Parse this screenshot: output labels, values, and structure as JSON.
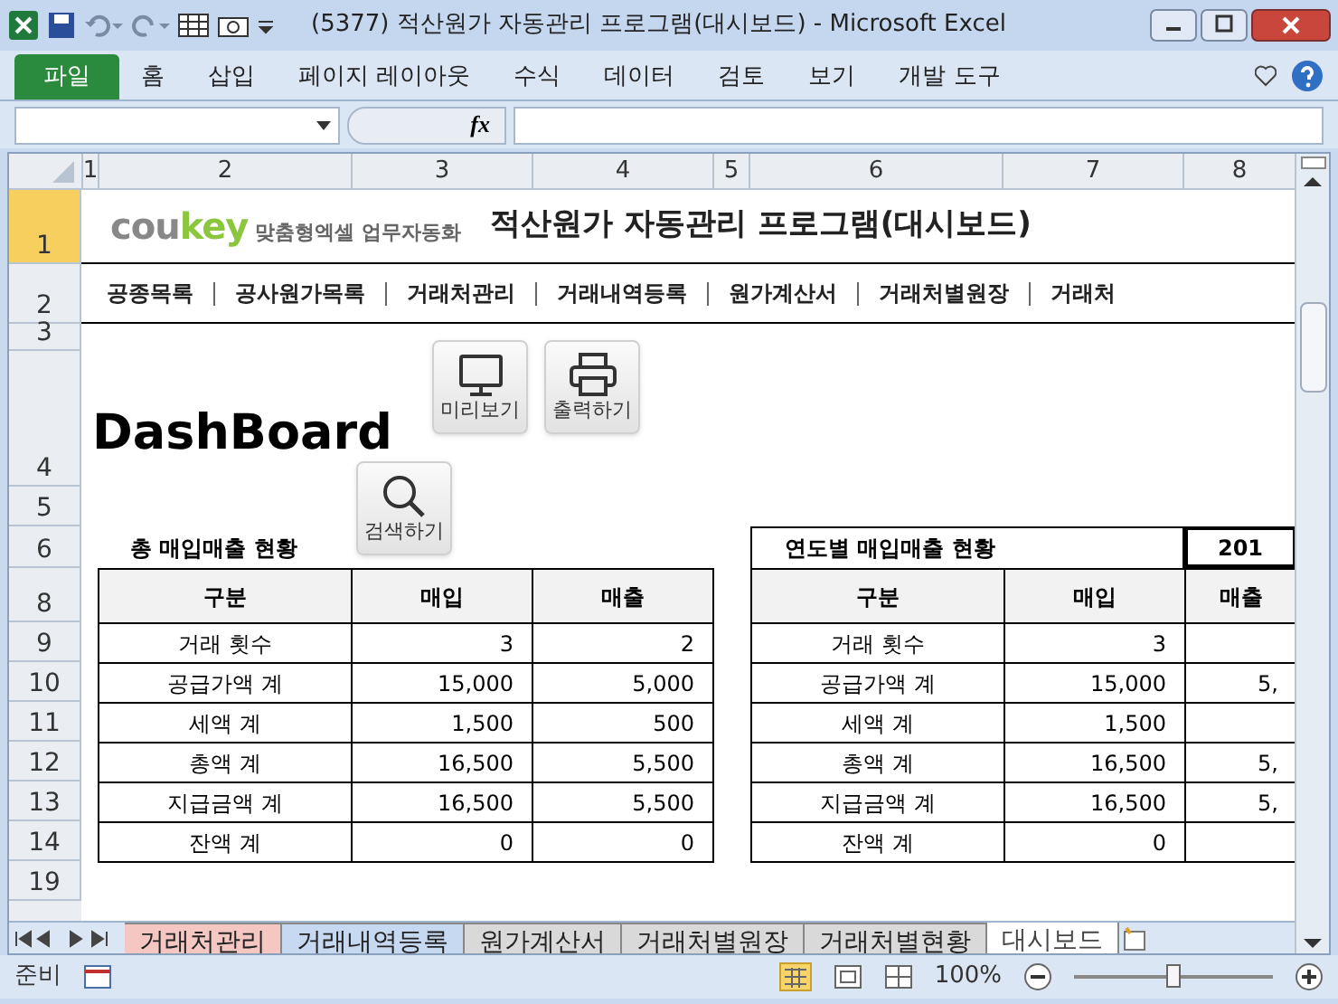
{
  "window": {
    "title": "(5377) 적산원가 자동관리 프로그램(대시보드)  -  Microsoft Excel"
  },
  "ribbon_tabs": [
    {
      "label": "파일",
      "selected": true
    },
    {
      "label": "홈",
      "selected": false
    },
    {
      "label": "삽입",
      "selected": false
    },
    {
      "label": "페이지 레이아웃",
      "selected": false
    },
    {
      "label": "수식",
      "selected": false
    },
    {
      "label": "데이터",
      "selected": false
    },
    {
      "label": "검토",
      "selected": false
    },
    {
      "label": "보기",
      "selected": false
    },
    {
      "label": "개발 도구",
      "selected": false
    }
  ],
  "formula_bar": {
    "fx": "fx"
  },
  "column_headers": [
    "1",
    "2",
    "3",
    "4",
    "5",
    "6",
    "7",
    "8"
  ],
  "row_headers": [
    {
      "label": "1",
      "selected": true
    },
    {
      "label": "2",
      "selected": false
    },
    {
      "label": "3",
      "selected": false
    },
    {
      "label": "4",
      "selected": false
    },
    {
      "label": "5",
      "selected": false
    },
    {
      "label": "6",
      "selected": false
    },
    {
      "label": "8",
      "selected": false
    },
    {
      "label": "9",
      "selected": false
    },
    {
      "label": "10",
      "selected": false
    },
    {
      "label": "11",
      "selected": false
    },
    {
      "label": "12",
      "selected": false
    },
    {
      "label": "13",
      "selected": false
    },
    {
      "label": "14",
      "selected": false
    },
    {
      "label": "19",
      "selected": false
    }
  ],
  "logo": {
    "brand_a": "cou",
    "brand_b": "key",
    "tagline": "맞춤형엑셀 업무자동화"
  },
  "sheet_title": "적산원가 자동관리 프로그램(대시보드)",
  "nav": [
    "공종목록",
    "공사원가목록",
    "거래처관리",
    "거래내역등록",
    "원가계산서",
    "거래처별원장",
    "거래처"
  ],
  "heading": "DashBoard",
  "buttons": [
    {
      "kind": "monitor",
      "label": "미리보기"
    },
    {
      "kind": "printer",
      "label": "출력하기"
    },
    {
      "kind": "search",
      "label": "검색하기"
    }
  ],
  "tables": [
    {
      "title": "총 매입매출 현황",
      "columns": [
        "구분",
        "매입",
        "매출"
      ],
      "rows": [
        [
          "거래 횟수",
          "3",
          "2"
        ],
        [
          "공급가액 계",
          "15,000",
          "5,000"
        ],
        [
          "세액 계",
          "1,500",
          "500"
        ],
        [
          "총액 계",
          "16,500",
          "5,500"
        ],
        [
          "지급금액 계",
          "16,500",
          "5,500"
        ],
        [
          "잔액 계",
          "0",
          "0"
        ]
      ]
    },
    {
      "title": "연도별 매입매출 현황",
      "year": "201",
      "columns": [
        "구분",
        "매입",
        "매출"
      ],
      "rows": [
        [
          "거래 횟수",
          "3",
          ""
        ],
        [
          "공급가액 계",
          "15,000",
          "5,"
        ],
        [
          "세액 계",
          "1,500",
          ""
        ],
        [
          "총액 계",
          "16,500",
          "5,"
        ],
        [
          "지급금액 계",
          "16,500",
          "5,"
        ],
        [
          "잔액 계",
          "0",
          ""
        ]
      ]
    }
  ],
  "sheet_tabs": [
    {
      "label": "거래처관리",
      "color": "#f4c7c3",
      "selected": false
    },
    {
      "label": "거래내역등록",
      "color": "#c6d9f1",
      "selected": false
    },
    {
      "label": "원가계산서",
      "color": "#d9d9d9",
      "selected": false
    },
    {
      "label": "거래처별원장",
      "color": "#d9d9d9",
      "selected": false
    },
    {
      "label": "거래처별현황",
      "color": "#d9d9d9",
      "selected": false
    },
    {
      "label": "대시보드",
      "color": "#ffffff",
      "selected": true
    }
  ],
  "status_bar": {
    "status": "준비",
    "zoom": "100%",
    "level": 0.5
  }
}
